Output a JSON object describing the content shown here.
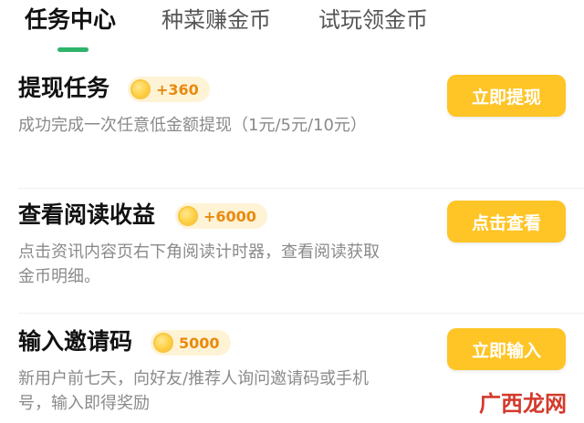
{
  "tabs": [
    {
      "label": "任务中心",
      "active": true
    },
    {
      "label": "种菜赚金币",
      "active": false
    },
    {
      "label": "试玩领金币",
      "active": false
    }
  ],
  "tasks": [
    {
      "title": "提现任务",
      "reward": "+360",
      "description": "成功完成一次任意低金额提现（1元/5元/10元）",
      "action": "立即提现"
    },
    {
      "title": "查看阅读收益",
      "reward": "+6000",
      "description": "点击资讯内容页右下角阅读计时器，查看阅读获取金币明细。",
      "action": "点击查看"
    },
    {
      "title": "输入邀请码",
      "reward": "5000",
      "description": "新用户前七天，向好友/推荐人询问邀请码或手机号，输入即得奖励",
      "action": "立即输入"
    }
  ],
  "watermark": "广西龙网",
  "colors": {
    "accent_green": "#2fb36b",
    "button_yellow": "#ffc425",
    "reward_orange": "#e88a10",
    "reward_bg": "#fff3d6"
  },
  "icons": {
    "reward_icon": "coin-icon"
  }
}
